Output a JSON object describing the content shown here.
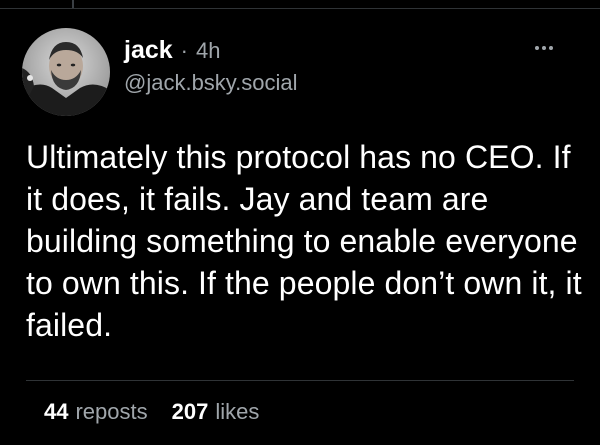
{
  "post": {
    "author": {
      "display_name": "jack",
      "handle": "@jack.bsky.social",
      "avatar_icon": "profile-photo"
    },
    "separator": "·",
    "time": "4h",
    "more_icon": "ellipsis-icon",
    "text": "Ultimately this protocol has no CEO. If it does, it fails. Jay and team are building something to enable everyone to own this. If the people don’t own it, it failed.",
    "stats": {
      "reposts_count": "44",
      "reposts_label": "reposts",
      "likes_count": "207",
      "likes_label": "likes"
    }
  },
  "colors": {
    "background": "#000000",
    "text_primary": "#ffffff",
    "text_secondary": "#a0a6ab",
    "divider": "#2f3336"
  }
}
